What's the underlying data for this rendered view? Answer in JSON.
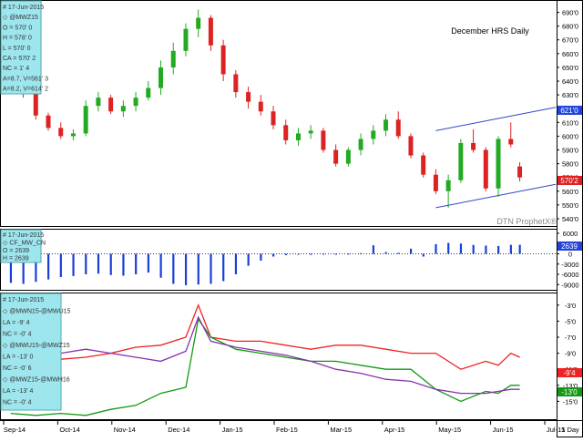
{
  "chart_title": "December HRS Daily",
  "watermark": "DTN ProphetX®",
  "x_axis": {
    "tick_labels": [
      "Sep-14",
      "Oct-14",
      "Nov-14",
      "Dec-14",
      "Jan-15",
      "Feb-15",
      "Mar-15",
      "Apr-15",
      "May-15",
      "Jun-15",
      "Jul-15"
    ],
    "corner_label": "1 Day"
  },
  "colors": {
    "up_candle": "#22aa22",
    "down_candle": "#dd2222",
    "spread_bars": "#1a3fd6",
    "channel": "#3344cc",
    "red_line": "#ee2222",
    "green_line": "#119911",
    "purple_line": "#8833aa",
    "legend_bg": "#9ee6ee"
  },
  "panels": {
    "price": {
      "legend": [
        "# 17-Jun-2015",
        "◇ @MWZ15",
        "O = 570' 0",
        "H = 578' 0",
        "L = 570' 0",
        "CA = 570' 2",
        "NC = 1' 4",
        "A=8.7, V=561' 3",
        "A=8.2, V=614' 2"
      ],
      "y_ticks": [
        "690'0",
        "680'0",
        "670'0",
        "660'0",
        "650'0",
        "640'0",
        "630'0",
        "620'0",
        "610'0",
        "600'0",
        "590'0",
        "580'0",
        "570'0",
        "560'0",
        "550'0",
        "540'0"
      ],
      "last_tags": [
        "621'0",
        "570'2"
      ]
    },
    "spread": {
      "legend": [
        "# 17-Jun-2015",
        "◇ CF_MW_CN",
        "O = 2639",
        "H = 2639"
      ],
      "y_ticks": [
        "-9000",
        "-6000",
        "-3000",
        "0",
        "3000",
        "6000"
      ],
      "last_tag": "2639"
    },
    "lines": {
      "legend": [
        "# 17-Jun-2015",
        "◇ @MWN15-@MWU15",
        "LA = -9' 4",
        "NC = -0' 4",
        "◇ @MWU15-@MWZ15",
        "LA = -13' 0",
        "NC = -0' 6",
        "◇ @MWZ15-@MWH16",
        "LA = -13' 4",
        "NC = -0' 4"
      ],
      "y_ticks": [
        "-3'0",
        "-5'0",
        "-7'0",
        "-9'0",
        "-11'0",
        "-13'0",
        "-15'0"
      ],
      "last_tags": [
        "-9'4",
        "-13'0"
      ]
    }
  },
  "chart_data": [
    {
      "type": "candlestick",
      "title": "December HRS Daily",
      "symbol": "@MWZ15",
      "ylim": [
        540,
        695
      ],
      "x_start": "2014-09-01",
      "x_end": "2015-07-01",
      "series": [
        {
          "name": "@MWZ15",
          "points": [
            [
              "2014-09-05",
              650,
              655,
              640,
              645
            ],
            [
              "2014-09-12",
              644,
              646,
              628,
              632
            ],
            [
              "2014-09-19",
              632,
              634,
              612,
              615
            ],
            [
              "2014-09-26",
              615,
              617,
              604,
              606
            ],
            [
              "2014-10-03",
              606,
              610,
              598,
              600
            ],
            [
              "2014-10-10",
              600,
              605,
              597,
              602
            ],
            [
              "2014-10-17",
              602,
              626,
              600,
              622
            ],
            [
              "2014-10-24",
              622,
              632,
              618,
              628
            ],
            [
              "2014-10-31",
              628,
              630,
              616,
              618
            ],
            [
              "2014-11-07",
              618,
              626,
              614,
              622
            ],
            [
              "2014-11-14",
              622,
              632,
              618,
              628
            ],
            [
              "2014-11-21",
              628,
              640,
              626,
              635
            ],
            [
              "2014-11-28",
              635,
              655,
              630,
              650
            ],
            [
              "2014-12-05",
              650,
              668,
              645,
              662
            ],
            [
              "2014-12-12",
              662,
              682,
              658,
              678
            ],
            [
              "2014-12-19",
              678,
              692,
              672,
              686
            ],
            [
              "2014-12-26",
              686,
              688,
              662,
              666
            ],
            [
              "2015-01-02",
              666,
              670,
              640,
              645
            ],
            [
              "2015-01-09",
              645,
              648,
              628,
              632
            ],
            [
              "2015-01-16",
              632,
              636,
              620,
              625
            ],
            [
              "2015-01-23",
              625,
              630,
              615,
              618
            ],
            [
              "2015-01-30",
              618,
              622,
              605,
              608
            ],
            [
              "2015-02-06",
              608,
              612,
              594,
              597
            ],
            [
              "2015-02-13",
              597,
              606,
              593,
              602
            ],
            [
              "2015-02-20",
              602,
              608,
              598,
              604
            ],
            [
              "2015-02-27",
              604,
              606,
              588,
              590
            ],
            [
              "2015-03-06",
              590,
              594,
              578,
              580
            ],
            [
              "2015-03-13",
              580,
              592,
              578,
              590
            ],
            [
              "2015-03-20",
              590,
              602,
              586,
              598
            ],
            [
              "2015-03-27",
              598,
              608,
              594,
              604
            ],
            [
              "2015-04-03",
              604,
              616,
              600,
              612
            ],
            [
              "2015-04-10",
              612,
              618,
              598,
              600
            ],
            [
              "2015-04-17",
              600,
              602,
              584,
              586
            ],
            [
              "2015-04-24",
              586,
              588,
              570,
              572
            ],
            [
              "2015-05-01",
              572,
              576,
              558,
              560
            ],
            [
              "2015-05-08",
              560,
              572,
              548,
              568
            ],
            [
              "2015-05-15",
              568,
              598,
              566,
              595
            ],
            [
              "2015-05-22",
              595,
              605,
              588,
              590
            ],
            [
              "2015-05-29",
              590,
              592,
              560,
              562
            ],
            [
              "2015-06-05",
              562,
              600,
              556,
              598
            ],
            [
              "2015-06-12",
              598,
              610,
              592,
              594
            ],
            [
              "2015-06-17",
              578,
              581,
              567,
              570
            ]
          ]
        }
      ],
      "channel": {
        "upper": [
          [
            "2015-05-01",
            604
          ],
          [
            "2015-06-29",
            621
          ]
        ],
        "lower": [
          [
            "2015-05-01",
            548
          ],
          [
            "2015-06-29",
            565
          ]
        ]
      },
      "last_values": [
        621,
        570.25
      ]
    },
    {
      "type": "bar",
      "title": "CF_MW_CN",
      "ylim": [
        -10000,
        6000
      ],
      "x": [
        "2014-09-05",
        "2014-09-12",
        "2014-09-19",
        "2014-09-26",
        "2014-10-03",
        "2014-10-10",
        "2014-10-17",
        "2014-10-24",
        "2014-10-31",
        "2014-11-07",
        "2014-11-14",
        "2014-11-21",
        "2014-11-28",
        "2014-12-05",
        "2014-12-12",
        "2014-12-19",
        "2014-12-26",
        "2015-01-02",
        "2015-01-09",
        "2015-01-16",
        "2015-01-23",
        "2015-01-30",
        "2015-02-06",
        "2015-02-13",
        "2015-02-20",
        "2015-02-27",
        "2015-03-06",
        "2015-03-13",
        "2015-03-20",
        "2015-03-27",
        "2015-04-03",
        "2015-04-10",
        "2015-04-17",
        "2015-04-24",
        "2015-05-01",
        "2015-05-08",
        "2015-05-15",
        "2015-05-22",
        "2015-05-29",
        "2015-06-05",
        "2015-06-12",
        "2015-06-17"
      ],
      "values": [
        -8500,
        -8800,
        -8200,
        -7500,
        -6800,
        -6500,
        -6000,
        -5800,
        -6200,
        -6400,
        -6000,
        -5500,
        -7000,
        -8800,
        -9200,
        -9000,
        -8800,
        -8000,
        -6000,
        -3500,
        -2000,
        -800,
        -400,
        -200,
        -300,
        -200,
        -100,
        50,
        200,
        2500,
        500,
        300,
        1500,
        -800,
        2800,
        3200,
        3000,
        2600,
        2400,
        2300,
        2639,
        2639
      ],
      "last_value": 2639
    },
    {
      "type": "line",
      "ylim": [
        -17,
        -2
      ],
      "x": [
        "2014-09-05",
        "2014-09-19",
        "2014-10-03",
        "2014-10-17",
        "2014-10-31",
        "2014-11-14",
        "2014-11-28",
        "2014-12-12",
        "2014-12-19",
        "2014-12-26",
        "2015-01-09",
        "2015-01-23",
        "2015-02-06",
        "2015-02-20",
        "2015-03-06",
        "2015-03-20",
        "2015-04-03",
        "2015-04-17",
        "2015-05-01",
        "2015-05-15",
        "2015-05-29",
        "2015-06-05",
        "2015-06-12",
        "2015-06-17"
      ],
      "series": [
        {
          "name": "@MWN15-@MWU15",
          "values": [
            -10.5,
            -10,
            -9.75,
            -9.5,
            -9,
            -8.25,
            -8,
            -7,
            -3,
            -7,
            -7.5,
            -7.5,
            -8,
            -8.5,
            -8,
            -8,
            -8.5,
            -9,
            -9,
            -11,
            -10,
            -10.5,
            -9,
            -9.5
          ]
        },
        {
          "name": "@MWU15-@MWZ15",
          "values": [
            -16.5,
            -16.75,
            -16.5,
            -16.75,
            -16,
            -15.5,
            -14,
            -13.25,
            -4.75,
            -7,
            -8.5,
            -9,
            -9.5,
            -10,
            -10,
            -10.5,
            -11,
            -11,
            -13.5,
            -15,
            -13.75,
            -14,
            -13,
            -13
          ]
        },
        {
          "name": "@MWZ15-@MWH16",
          "values": [
            -9.5,
            -9.25,
            -9,
            -8.5,
            -9,
            -9.5,
            -10,
            -8.75,
            -4.5,
            -7.5,
            -8.25,
            -8.75,
            -9.25,
            -10,
            -11,
            -11.5,
            -12.25,
            -12.5,
            -13.5,
            -14,
            -14,
            -13.75,
            -13.5,
            -13.5
          ]
        }
      ],
      "last_values": [
        -9.5,
        -13
      ]
    }
  ]
}
